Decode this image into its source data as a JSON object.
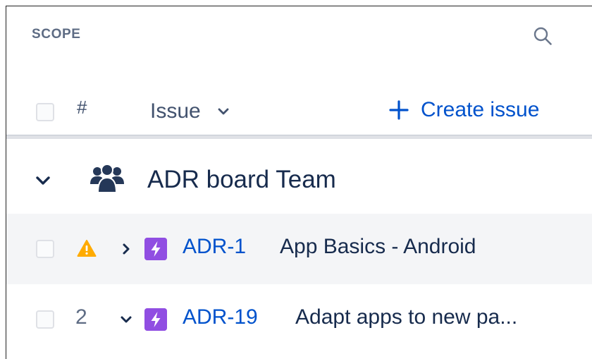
{
  "header": {
    "scope_label": "SCOPE",
    "search_icon": "search-icon"
  },
  "columns": {
    "rank_label": "#",
    "issue_sort_label": "Issue",
    "create_issue_label": "Create issue"
  },
  "group": {
    "name": "ADR board Team",
    "icon": "team-icon",
    "expanded": true
  },
  "issues": [
    {
      "rank": "",
      "warning": true,
      "expanded": false,
      "type_icon": "epic-icon",
      "key": "ADR-1",
      "summary": "App Basics - Android"
    },
    {
      "rank": "2",
      "warning": false,
      "expanded": true,
      "type_icon": "epic-icon",
      "key": "ADR-19",
      "summary": "Adapt apps to new pa..."
    }
  ],
  "colors": {
    "link": "#0052cc",
    "epic": "#904ee2",
    "warning": "#ffab00",
    "row_highlight": "#f4f5f7"
  }
}
